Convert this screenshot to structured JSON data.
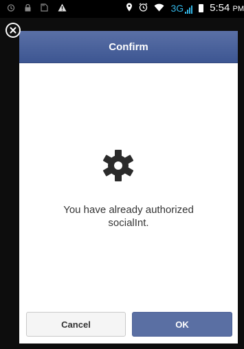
{
  "status_bar": {
    "network_label": "3G",
    "time": "5:54",
    "time_suffix": "PM",
    "accent_color": "#33b5e5"
  },
  "dialog": {
    "title": "Confirm",
    "icon": "gear-icon",
    "message_line1": "You have already authorized",
    "message_line2": "socialInt.",
    "buttons": {
      "cancel_label": "Cancel",
      "ok_label": "OK"
    },
    "header_color": "#4b62a0"
  }
}
